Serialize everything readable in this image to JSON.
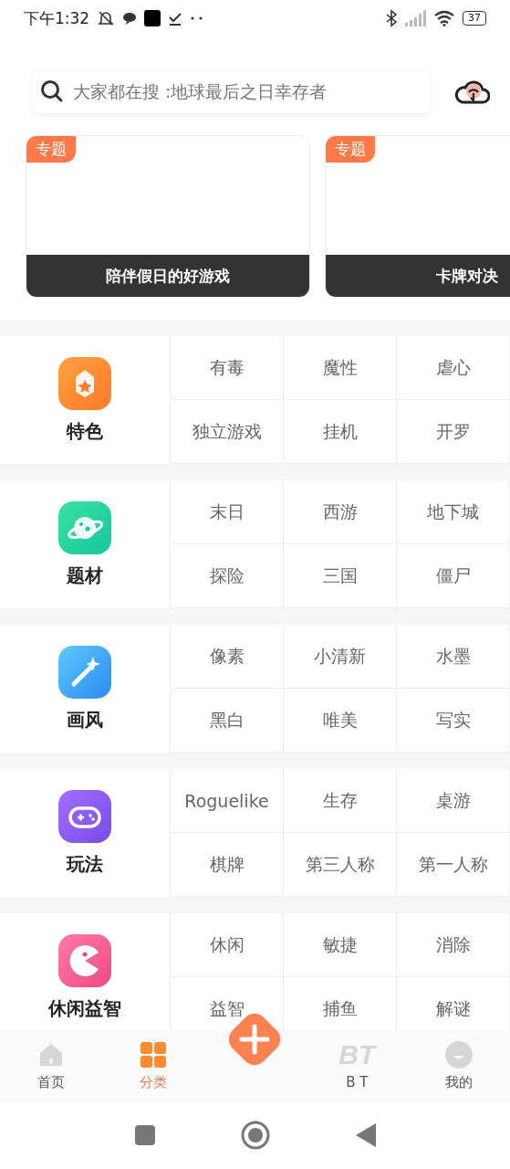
{
  "status_bar": {
    "time": "下午1:32",
    "battery": "37"
  },
  "search": {
    "placeholder": "大家都在搜 :地球最后之日幸存者"
  },
  "topics": [
    {
      "badge": "专题",
      "title": "陪伴假日的好游戏"
    },
    {
      "badge": "专题",
      "title": "卡牌对决"
    }
  ],
  "categories": [
    {
      "kind": "badge",
      "name": "特色",
      "tags": [
        "有毒",
        "魔性",
        "虐心",
        "独立游戏",
        "挂机",
        "开罗"
      ]
    },
    {
      "kind": "planet",
      "name": "题材",
      "tags": [
        "末日",
        "西游",
        "地下城",
        "探险",
        "三国",
        "僵尸"
      ]
    },
    {
      "kind": "wand",
      "name": "画风",
      "tags": [
        "像素",
        "小清新",
        "水墨",
        "黑白",
        "唯美",
        "写实"
      ]
    },
    {
      "kind": "gamepad",
      "name": "玩法",
      "tags": [
        "Roguelike",
        "生存",
        "桌游",
        "棋牌",
        "第三人称",
        "第一人称"
      ]
    },
    {
      "kind": "pacman",
      "name": "休闲益智",
      "tags": [
        "休闲",
        "敏捷",
        "消除",
        "益智",
        "捕鱼",
        "解谜"
      ]
    }
  ],
  "tab_bar": [
    {
      "kind": "home",
      "label": "首页",
      "selected": false
    },
    {
      "kind": "grid",
      "label": "分类",
      "selected": true
    },
    {
      "kind": "add"
    },
    {
      "kind": "bt",
      "icon_text": "BT",
      "label": "B T",
      "selected": false
    },
    {
      "kind": "me",
      "label": "我的",
      "selected": false
    }
  ]
}
